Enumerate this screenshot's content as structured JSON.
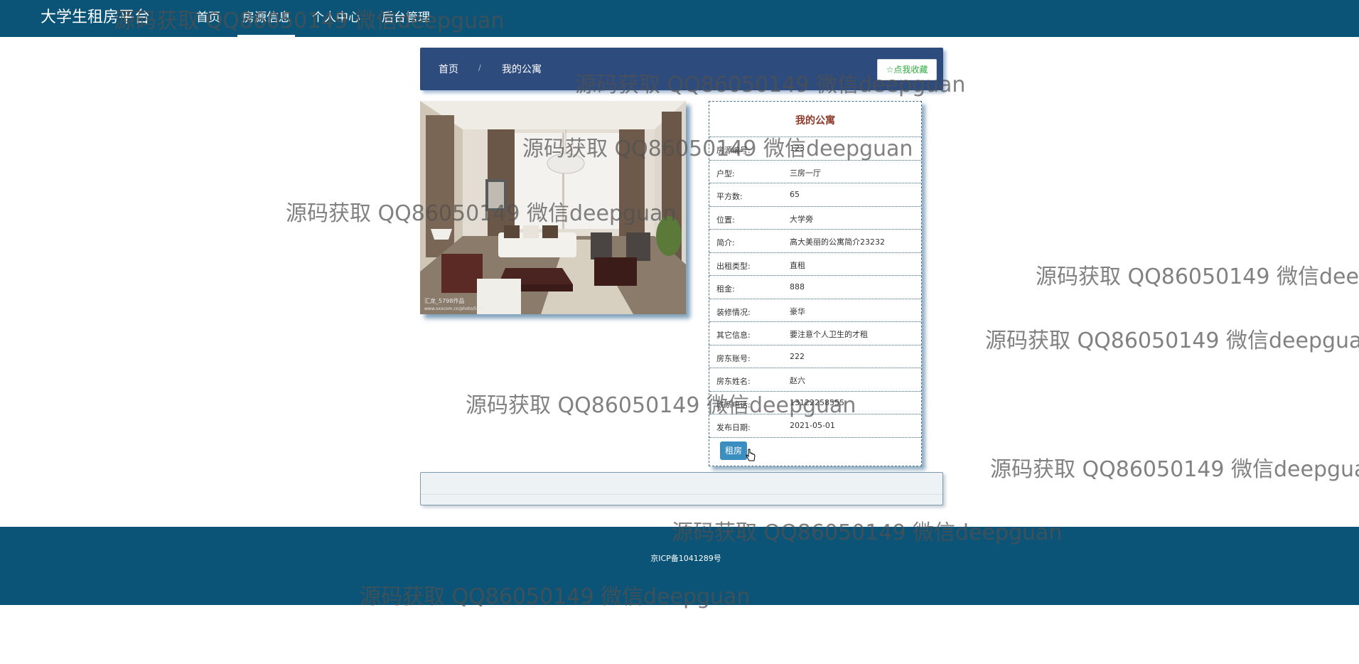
{
  "nav": {
    "brand": "大学生租房平台",
    "links": [
      "首页",
      "房源信息",
      "个人中心",
      "后台管理"
    ]
  },
  "breadcrumb": {
    "home": "首页",
    "separator": "/",
    "current": "我的公寓",
    "favorite_button": "☆点我收藏"
  },
  "details": {
    "title": "我的公寓",
    "rows": [
      {
        "label": "房源编号:",
        "value": "123"
      },
      {
        "label": "户型:",
        "value": "三房一厅"
      },
      {
        "label": "平方数:",
        "value": "65"
      },
      {
        "label": "位置:",
        "value": "大学旁"
      },
      {
        "label": "简介:",
        "value": "高大美丽的公寓简介23232"
      },
      {
        "label": "出租类型:",
        "value": "直租"
      },
      {
        "label": "租金:",
        "value": "888"
      },
      {
        "label": "装修情况:",
        "value": "豪华"
      },
      {
        "label": "其它信息:",
        "value": "要注意个人卫生的才租"
      },
      {
        "label": "房东账号:",
        "value": "222"
      },
      {
        "label": "房东姓名:",
        "value": "赵六"
      },
      {
        "label": "联系电话:",
        "value": "13122258555"
      },
      {
        "label": "发布日期:",
        "value": "2021-05-01"
      }
    ],
    "rent_button": "租房"
  },
  "photo": {
    "caption_line1": "汇龙_5798作品",
    "caption_line2": "www.xxxcom.cn/photo/5798"
  },
  "footer": {
    "icp": "京ICP备1041289号"
  },
  "watermark": {
    "text": "源码获取 QQ86050149 微信deepguan"
  },
  "colors": {
    "nav_bg": "#0b5478",
    "breadcrumb_bg": "#2d4b7c",
    "title_color": "#8b3a2b",
    "favorite_green": "#2eaa3e",
    "button_blue": "#3b8ec0"
  }
}
